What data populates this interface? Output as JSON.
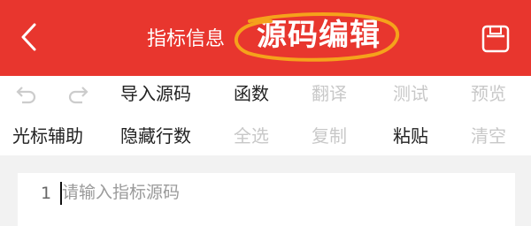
{
  "header": {
    "title": "指标信息",
    "overlay_title": "源码编辑",
    "back_icon": "chevron-left-icon",
    "save_icon": "save-icon",
    "background": "#e8362e",
    "highlight_color": "#f5a21b"
  },
  "toolbar": {
    "undo_icon": "undo-icon",
    "redo_icon": "redo-icon",
    "import_label": "导入源码",
    "functions_label": "函数",
    "translate_label": "翻译",
    "test_label": "测试",
    "preview_label": "预览",
    "cursor_assist_label": "光标辅助",
    "hide_line_numbers_label": "隐藏行数",
    "select_all_label": "全选",
    "copy_label": "复制",
    "paste_label": "粘贴",
    "clear_label": "清空"
  },
  "editor": {
    "line_number": "1",
    "placeholder": "请输入指标源码"
  }
}
